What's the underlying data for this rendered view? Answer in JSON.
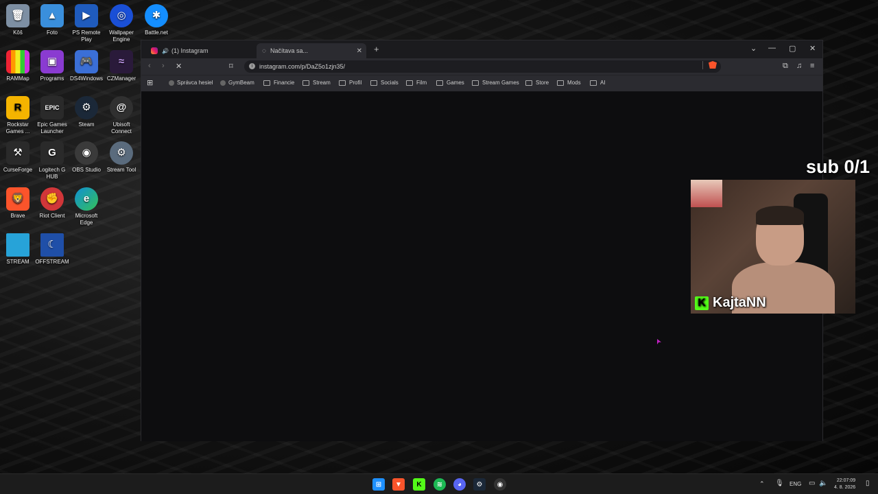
{
  "desktop": {
    "icons": [
      {
        "label": "Kôš",
        "icon": "recycle-bin-icon",
        "color": "#7d8fa3"
      },
      {
        "label": "Foto",
        "icon": "photos-icon",
        "color": "#3a8fdc"
      },
      {
        "label": "PS Remote Play",
        "icon": "ps-remote-play-icon",
        "color": "#1f5bbd"
      },
      {
        "label": "Wallpaper Engine",
        "icon": "wallpaper-engine-icon",
        "color": "#1a4fd6"
      },
      {
        "label": "Battle.net",
        "icon": "battlenet-icon",
        "color": "#148eff"
      },
      {
        "label": "RAMMap",
        "icon": "rammap-icon",
        "color": "#c23fd9"
      },
      {
        "label": "Programs",
        "icon": "programs-folder-icon",
        "color": "#8a3bd1"
      },
      {
        "label": "DS4Windows",
        "icon": "ds4windows-icon",
        "color": "#3b6fd6"
      },
      {
        "label": "CZManager",
        "icon": "czmanager-icon",
        "color": "#7a3bbd"
      },
      {
        "label": "Rockstar Games ...",
        "icon": "rockstar-icon",
        "color": "#f5b400"
      },
      {
        "label": "Epic Games Launcher",
        "icon": "epic-games-icon",
        "color": "#2a2a2a"
      },
      {
        "label": "Steam",
        "icon": "steam-icon",
        "color": "#1b2838"
      },
      {
        "label": "Ubisoft Connect",
        "icon": "ubisoft-icon",
        "color": "#303030"
      },
      {
        "label": "CurseForge",
        "icon": "curseforge-icon",
        "color": "#2a2a2a"
      },
      {
        "label": "Logitech G HUB",
        "icon": "logitech-ghub-icon",
        "color": "#2a2a2a"
      },
      {
        "label": "OBS Studio",
        "icon": "obs-icon",
        "color": "#3a3a3a"
      },
      {
        "label": "Stream Tool",
        "icon": "gear-icon",
        "color": "#5a6b7d"
      },
      {
        "label": "Brave",
        "icon": "brave-icon",
        "color": "#fb542b"
      },
      {
        "label": "Riot Client",
        "icon": "riot-client-icon",
        "color": "#d13639"
      },
      {
        "label": "Microsoft Edge",
        "icon": "edge-icon",
        "color": "#0f8fd4"
      },
      {
        "label": "STREAM",
        "icon": "monitor-icon",
        "color": "#27a3d8"
      },
      {
        "label": "OFFSTREAM",
        "icon": "moon-monitor-icon",
        "color": "#1f4fa8"
      }
    ]
  },
  "browser": {
    "tabs": [
      {
        "label": "(1) Instagram",
        "active": false
      },
      {
        "label": "Načítava sa...",
        "active": true
      }
    ],
    "new_tab": "+",
    "url": "instagram.com/p/DaZ5o1zjn35/",
    "bookmarks": [
      "Správca hesiel",
      "GymBeam",
      "Financie",
      "Stream",
      "Profil",
      "Socials",
      "Film",
      "Games",
      "Stream Games",
      "Store",
      "Mods",
      "AI"
    ]
  },
  "overlay": {
    "sub_goal": "sub 0/1",
    "streamer_name": "KajtaNN",
    "kick_logo": "K"
  },
  "taskbar": {
    "language": "ENG",
    "time": "22:07:09",
    "date": "4. 8. 2026"
  }
}
